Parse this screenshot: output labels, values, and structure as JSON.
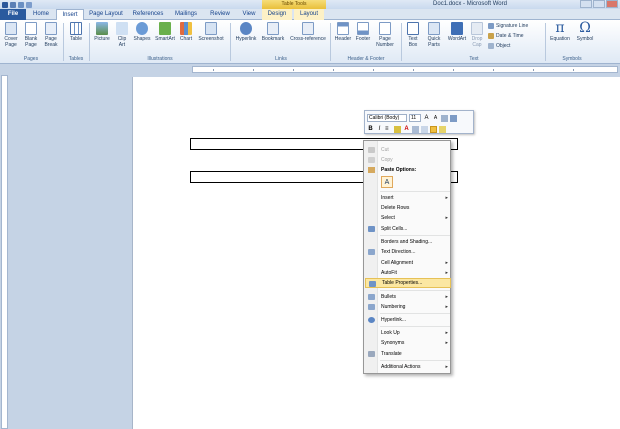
{
  "window": {
    "doc_title": "Doc1.docx - Microsoft Word",
    "context_group": "Table Tools"
  },
  "tabs": [
    "File",
    "Home",
    "Insert",
    "Page Layout",
    "References",
    "Mailings",
    "Review",
    "View",
    "Design",
    "Layout"
  ],
  "ribbon": {
    "pages": {
      "cover": "Cover\nPage",
      "blank": "Blank\nPage",
      "break": "Page\nBreak",
      "group": "Pages"
    },
    "tables": {
      "table": "Table",
      "group": "Tables"
    },
    "illustrations": {
      "picture": "Picture",
      "clipart": "Clip\nArt",
      "shapes": "Shapes",
      "smartart": "SmartArt",
      "chart": "Chart",
      "screenshot": "Screenshot",
      "group": "Illustrations"
    },
    "links": {
      "hyperlink": "Hyperlink",
      "bookmark": "Bookmark",
      "crossref": "Cross-reference",
      "group": "Links"
    },
    "header_footer": {
      "header": "Header",
      "footer": "Footer",
      "page_number": "Page\nNumber",
      "group": "Header & Footer"
    },
    "text": {
      "textbox": "Text\nBox",
      "quickparts": "Quick\nParts",
      "wordart": "WordArt",
      "dropcap": "Drop\nCap",
      "signature": "Signature Line",
      "datetime": "Date & Time",
      "object": "Object",
      "group": "Text"
    },
    "symbols": {
      "equation": "Equation",
      "symbol": "Symbol",
      "group": "Symbols"
    }
  },
  "mini_toolbar": {
    "font": "Calibri (Body)",
    "size": "11"
  },
  "context_menu": {
    "cut": "Cut",
    "copy": "Copy",
    "paste_options": "Paste Options:",
    "insert": "Insert",
    "delete_rows": "Delete Rows",
    "select": "Select",
    "split_cells": "Split Cells...",
    "borders": "Borders and Shading...",
    "text_direction": "Text Direction...",
    "cell_alignment": "Cell Alignment",
    "autofit": "AutoFit",
    "table_properties": "Table Properties...",
    "bullets": "Bullets",
    "numbering": "Numbering",
    "hyperlink": "Hyperlink...",
    "lookup": "Look Up",
    "synonyms": "Synonyms",
    "translate": "Translate",
    "additional": "Additional Actions"
  },
  "colors": {
    "accent": "#2a5a9e",
    "highlight": "#fbe7a2",
    "context_tab": "#f6dd7a"
  }
}
